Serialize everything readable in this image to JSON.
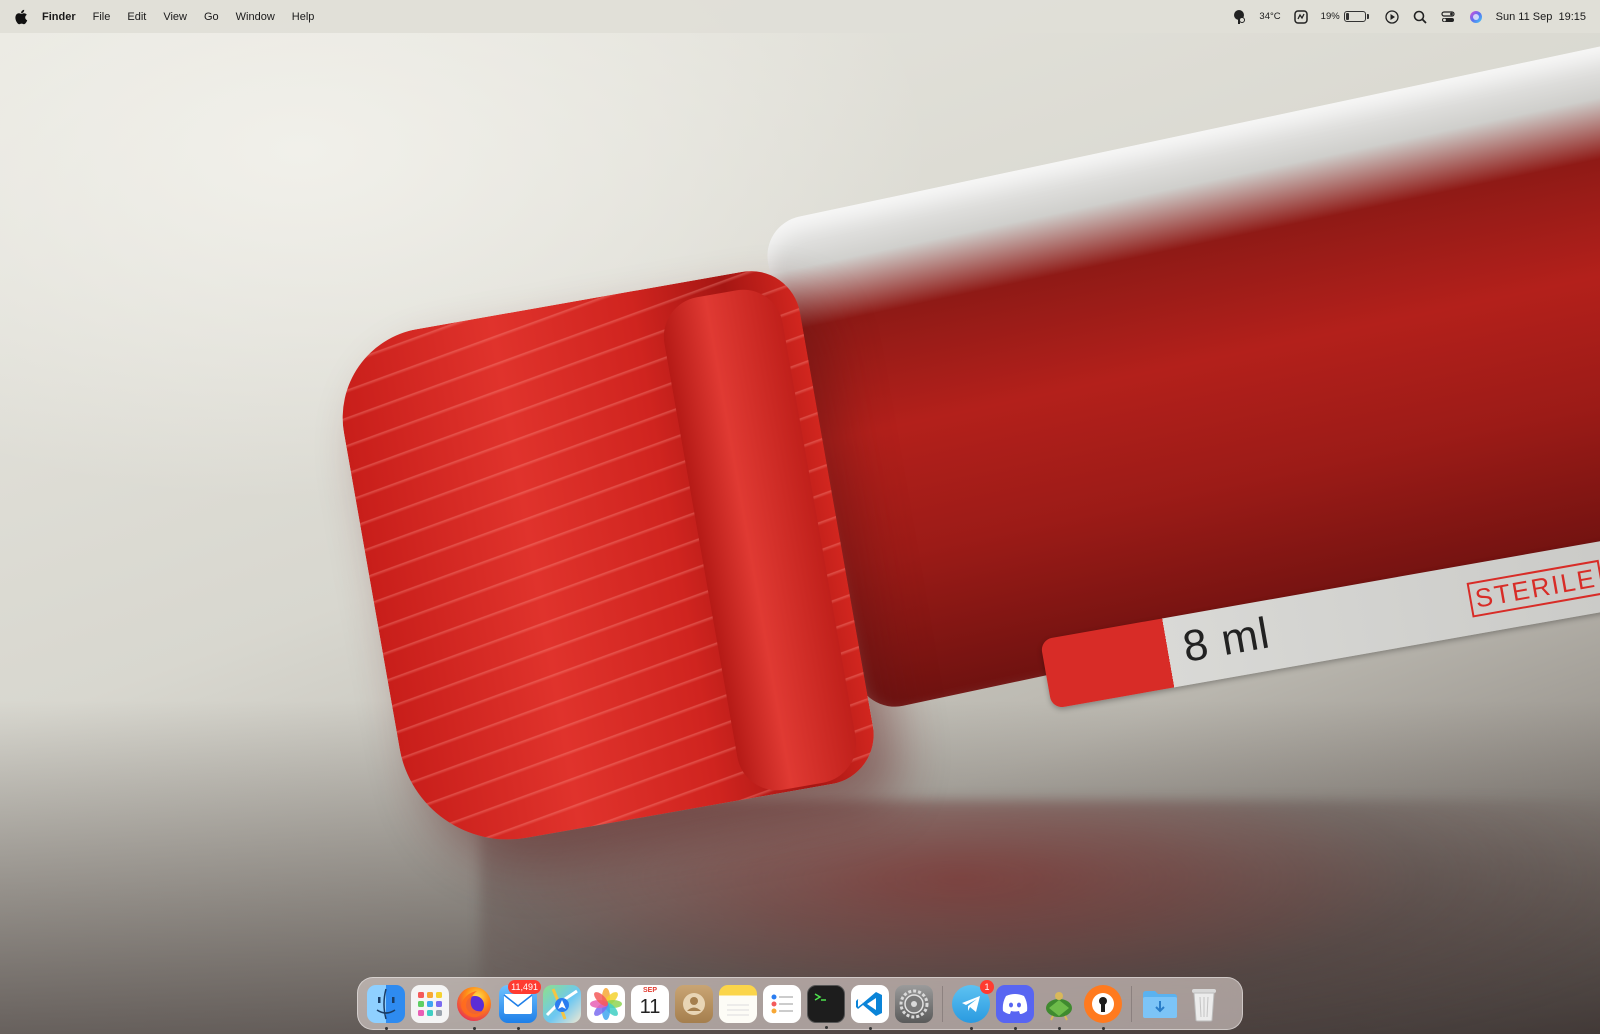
{
  "menubar": {
    "app_name": "Finder",
    "items": [
      "File",
      "Edit",
      "View",
      "Go",
      "Window",
      "Help"
    ],
    "status": {
      "temperature": "34°C",
      "battery_percent": "19%",
      "battery_level": 0.19,
      "datetime": "Sun 11 Sep  19:15"
    }
  },
  "wallpaper": {
    "label_text": "8 ml",
    "label_brand_text": "STERILE"
  },
  "dock": {
    "apps": [
      {
        "name": "Finder",
        "icon": "finder-icon",
        "running": true
      },
      {
        "name": "Launchpad",
        "icon": "launchpad-icon",
        "running": false
      },
      {
        "name": "Firefox",
        "icon": "firefox-icon",
        "running": true
      },
      {
        "name": "Mail",
        "icon": "mail-icon",
        "running": true,
        "badge": "11,491"
      },
      {
        "name": "Maps",
        "icon": "maps-icon",
        "running": false
      },
      {
        "name": "Photos",
        "icon": "photos-icon",
        "running": false
      },
      {
        "name": "Calendar",
        "icon": "calendar-icon",
        "running": false,
        "month": "SEP",
        "day": "11"
      },
      {
        "name": "Contacts",
        "icon": "contacts-icon",
        "running": false
      },
      {
        "name": "Notes",
        "icon": "notes-icon",
        "running": false
      },
      {
        "name": "Reminders",
        "icon": "reminders-icon",
        "running": false
      },
      {
        "name": "Terminal",
        "icon": "terminal-icon",
        "running": true
      },
      {
        "name": "Visual Studio Code",
        "icon": "vscode-icon",
        "running": true
      },
      {
        "name": "System Preferences",
        "icon": "system-preferences-icon",
        "running": false
      },
      {
        "name": "Telegram",
        "icon": "telegram-icon",
        "running": true,
        "badge": "1"
      },
      {
        "name": "Discord",
        "icon": "discord-icon",
        "running": true
      },
      {
        "name": "Cyberduck",
        "icon": "turtle-app-icon",
        "running": true
      },
      {
        "name": "Keybase",
        "icon": "keyhole-app-icon",
        "running": true
      },
      {
        "name": "Downloads",
        "icon": "downloads-folder-icon",
        "running": false
      },
      {
        "name": "Trash",
        "icon": "trash-icon",
        "running": false
      }
    ]
  }
}
